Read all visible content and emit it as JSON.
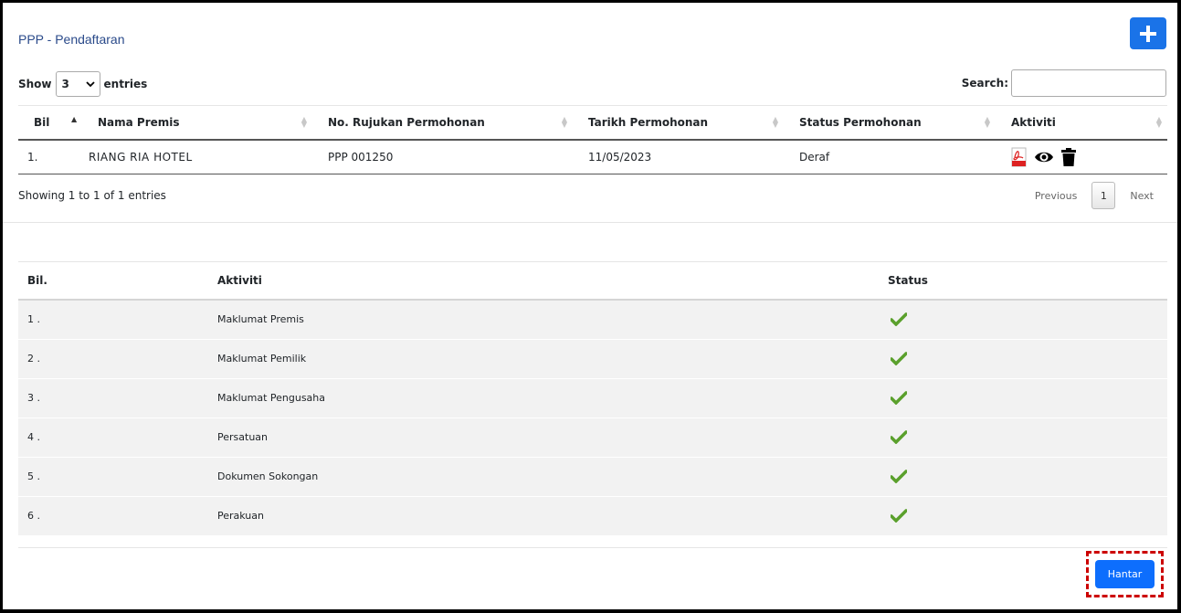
{
  "header": {
    "title": "PPP - Pendaftaran",
    "add_icon": "plus-icon"
  },
  "controls": {
    "show_label": "Show",
    "entries_value": "3",
    "entries_label": "entries",
    "search_label": "Search:",
    "search_value": ""
  },
  "table": {
    "headers": [
      "Bil",
      "Nama Premis",
      "No. Rujukan Permohonan",
      "Tarikh Permohonan",
      "Status Permohonan",
      "Aktiviti"
    ],
    "rows": [
      {
        "bil": "1.",
        "nama": "RIANG RIA HOTEL",
        "rujukan": "PPP 001250",
        "tarikh": "11/05/2023",
        "status": "Deraf",
        "actions": [
          "pdf-icon",
          "eye-icon",
          "trash-icon"
        ]
      }
    ]
  },
  "footer": {
    "showing": "Showing 1 to 1 of 1 entries",
    "previous": "Previous",
    "page": "1",
    "next": "Next"
  },
  "activity": {
    "headers": [
      "Bil.",
      "Aktiviti",
      "Status"
    ],
    "rows": [
      {
        "bil": "1 .",
        "aktiviti": "Maklumat Premis"
      },
      {
        "bil": "2 .",
        "aktiviti": "Maklumat Pemilik"
      },
      {
        "bil": "3 .",
        "aktiviti": "Maklumat Pengusaha"
      },
      {
        "bil": "4 .",
        "aktiviti": "Persatuan"
      },
      {
        "bil": "5 .",
        "aktiviti": "Dokumen Sokongan"
      },
      {
        "bil": "6 .",
        "aktiviti": "Perakuan"
      }
    ],
    "status_icon": "checkmark-icon",
    "check_color": "#5aa02c"
  },
  "submit": {
    "label": "Hantar"
  },
  "colors": {
    "primary": "#0d6efd",
    "title": "#2a4a8a",
    "highlight": "#cc0000"
  }
}
